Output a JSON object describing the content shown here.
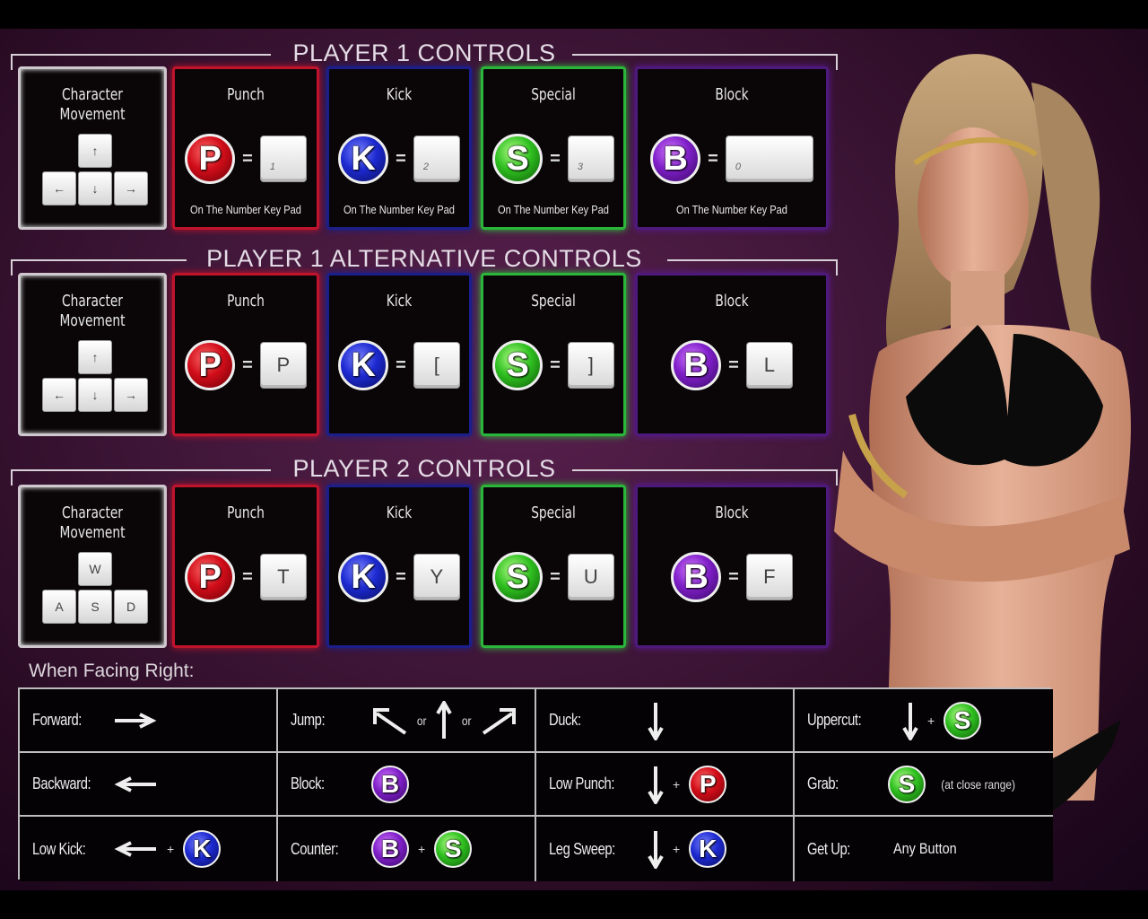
{
  "sections": [
    {
      "title": "PLAYER 1 CONTROLS",
      "movement": {
        "label_line1": "Character",
        "label_line2": "Movement",
        "keys": {
          "up": "↑",
          "left": "←",
          "down": "↓",
          "right": "→"
        }
      },
      "punch": {
        "label": "Punch",
        "button": "P",
        "key": "1",
        "foot": "On The Number Key Pad"
      },
      "kick": {
        "label": "Kick",
        "button": "K",
        "key": "2",
        "foot": "On The Number Key Pad"
      },
      "special": {
        "label": "Special",
        "button": "S",
        "key": "3",
        "foot": "On The Number Key Pad"
      },
      "block": {
        "label": "Block",
        "button": "B",
        "key": "0",
        "foot": "On The Number Key Pad"
      }
    },
    {
      "title": "PLAYER 1 ALTERNATIVE CONTROLS",
      "movement": {
        "label_line1": "Character",
        "label_line2": "Movement",
        "keys": {
          "up": "↑",
          "left": "←",
          "down": "↓",
          "right": "→"
        }
      },
      "punch": {
        "label": "Punch",
        "button": "P",
        "key": "P"
      },
      "kick": {
        "label": "Kick",
        "button": "K",
        "key": "["
      },
      "special": {
        "label": "Special",
        "button": "S",
        "key": "]"
      },
      "block": {
        "label": "Block",
        "button": "B",
        "key": "L"
      }
    },
    {
      "title": "PLAYER 2 CONTROLS",
      "movement": {
        "label_line1": "Character",
        "label_line2": "Movement",
        "keys": {
          "up": "W",
          "left": "A",
          "down": "S",
          "right": "D"
        }
      },
      "punch": {
        "label": "Punch",
        "button": "P",
        "key": "T"
      },
      "kick": {
        "label": "Kick",
        "button": "K",
        "key": "Y"
      },
      "special": {
        "label": "Special",
        "button": "S",
        "key": "U"
      },
      "block": {
        "label": "Block",
        "button": "B",
        "key": "F"
      }
    }
  ],
  "equals": "=",
  "facing": {
    "title": "When Facing Right:",
    "or": "or",
    "plus": "+",
    "moves": {
      "forward": "Forward:",
      "jump": "Jump:",
      "duck": "Duck:",
      "uppercut": "Uppercut:",
      "backward": "Backward:",
      "block": "Block:",
      "low_punch": "Low Punch:",
      "grab": "Grab:",
      "grab_note": "(at close range)",
      "low_kick": "Low Kick:",
      "counter": "Counter:",
      "leg_sweep": "Leg Sweep:",
      "get_up": "Get Up:",
      "get_up_value": "Any Button"
    }
  },
  "buttons": {
    "P": "P",
    "K": "K",
    "S": "S",
    "B": "B"
  },
  "colors": {
    "punch": "#c0132c",
    "kick": "#1c1f8a",
    "special": "#2bb53a",
    "block": "#4d1a7c",
    "background": "#3f1638"
  }
}
